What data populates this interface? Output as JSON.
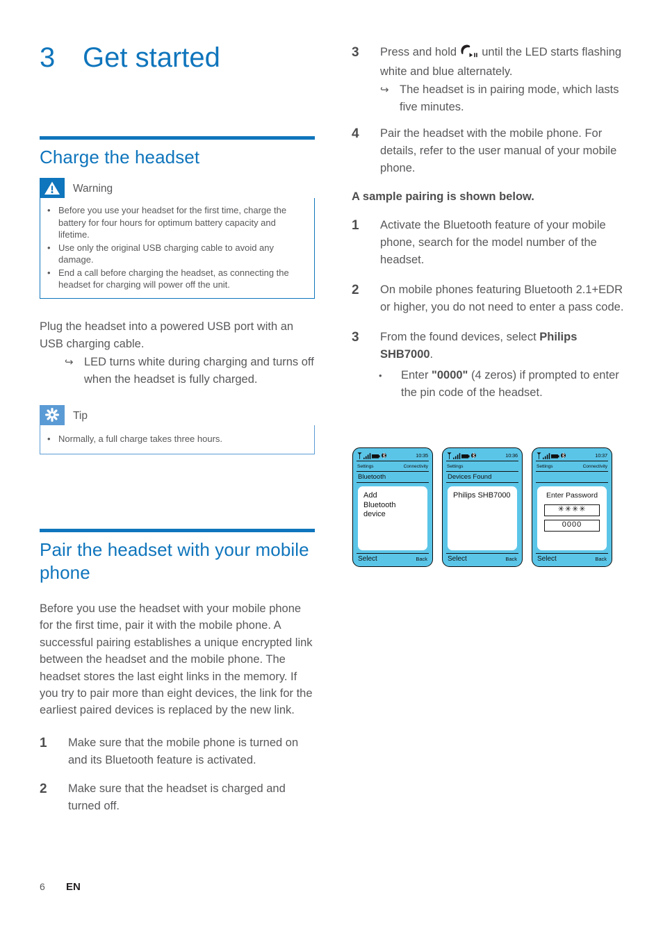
{
  "chapter": {
    "number": "3",
    "title": "Get started"
  },
  "left_column": {
    "section1": {
      "title": "Charge the headset",
      "warning": {
        "icon": "warning-triangle-icon",
        "label": "Warning",
        "items": [
          "Before you use your headset for the first time, charge the battery for four hours for optimum battery capacity and lifetime.",
          "Use only the original USB charging cable to avoid any damage.",
          "End a call before charging the headset, as connecting the headset for charging will power off the unit."
        ]
      },
      "paragraph": "Plug the headset into a powered USB port with an USB charging cable.",
      "result": {
        "marker": "↪",
        "text": "LED turns white during charging and turns off when the headset is fully charged."
      },
      "tip": {
        "icon": "tip-asterisk-icon",
        "label": "Tip",
        "items": [
          "Normally, a full charge takes three hours."
        ]
      }
    },
    "section2": {
      "title": "Pair the headset with your mobile phone",
      "paragraph": "Before you use the headset with your mobile phone for the first time, pair it with the mobile phone. A successful pairing establishes a unique encrypted link between the headset and the mobile phone. The headset stores the last eight links in the memory. If you try to pair more than eight devices, the link for the earliest paired devices is replaced by the new link.",
      "steps": [
        {
          "number": "1",
          "text": "Make sure that the mobile phone is turned on and its Bluetooth feature is activated."
        },
        {
          "number": "2",
          "text": "Make sure that the headset is charged and turned off."
        }
      ]
    }
  },
  "right_column": {
    "steps_continued": [
      {
        "number": "3",
        "text_before_icon": "Press and hold ",
        "icon": "phone-play-pause-button-icon",
        "text_after_icon": " until the LED starts flashing white and blue alternately.",
        "result": {
          "marker": "↪",
          "text": "The headset is in pairing mode, which lasts five minutes."
        }
      },
      {
        "number": "4",
        "text": "Pair the headset with the mobile phone. For details, refer to the user manual of your mobile phone."
      }
    ],
    "lead_in": "A sample pairing is shown below.",
    "sample_steps": [
      {
        "number": "1",
        "text": "Activate the Bluetooth feature of your mobile phone, search for the model number of the headset."
      },
      {
        "number": "2",
        "text": "On mobile phones featuring Bluetooth 2.1+EDR or higher, you do not need to enter a pass code."
      },
      {
        "number": "3",
        "prefix": "From the found devices, select ",
        "bold": "Philips SHB7000",
        "suffix": ".",
        "bullet": {
          "marker": "•",
          "prefix": "Enter ",
          "bold": "\"0000\"",
          "suffix": " (4 zeros) if prompted to enter the pin code of the headset."
        }
      }
    ]
  },
  "phone_figures": [
    {
      "name": "phone-screen-bluetooth",
      "status": {
        "icons": [
          "antenna-icon",
          "signal-bars-icon",
          "battery-icon",
          "bluetooth-icon"
        ],
        "time": "10:35"
      },
      "menu_left": "Settings",
      "menu_right": "Connectivity",
      "title": "Bluetooth",
      "content_lines": [
        "Add",
        "Bluetooth",
        "device"
      ],
      "softkey_left": "Select",
      "softkey_right": "Back"
    },
    {
      "name": "phone-screen-devices-found",
      "status": {
        "icons": [
          "antenna-icon",
          "signal-bars-icon",
          "battery-icon",
          "bluetooth-icon"
        ],
        "time": "10:36"
      },
      "menu_left": "Settings",
      "menu_right": "",
      "title": "Devices Found",
      "content_lines": [
        "Philips SHB7000"
      ],
      "softkey_left": "Select",
      "softkey_right": "Back"
    },
    {
      "name": "phone-screen-enter-password",
      "status": {
        "icons": [
          "antenna-icon",
          "signal-bars-icon",
          "battery-icon",
          "bluetooth-icon"
        ],
        "time": "10:37"
      },
      "menu_left": "Settings",
      "menu_right": "Connectivity",
      "title": "",
      "password": {
        "title": "Enter Password",
        "masked_value": "✳✳✳✳",
        "value": "0000"
      },
      "softkey_left": "Select",
      "softkey_right": "Back"
    }
  ],
  "footer": {
    "page_number": "6",
    "language": "EN"
  },
  "colors": {
    "brand_blue": "#0f75bc",
    "tip_blue": "#5b9bd5",
    "phone_cyan": "#5bc5e8",
    "body_gray": "#58585b"
  }
}
